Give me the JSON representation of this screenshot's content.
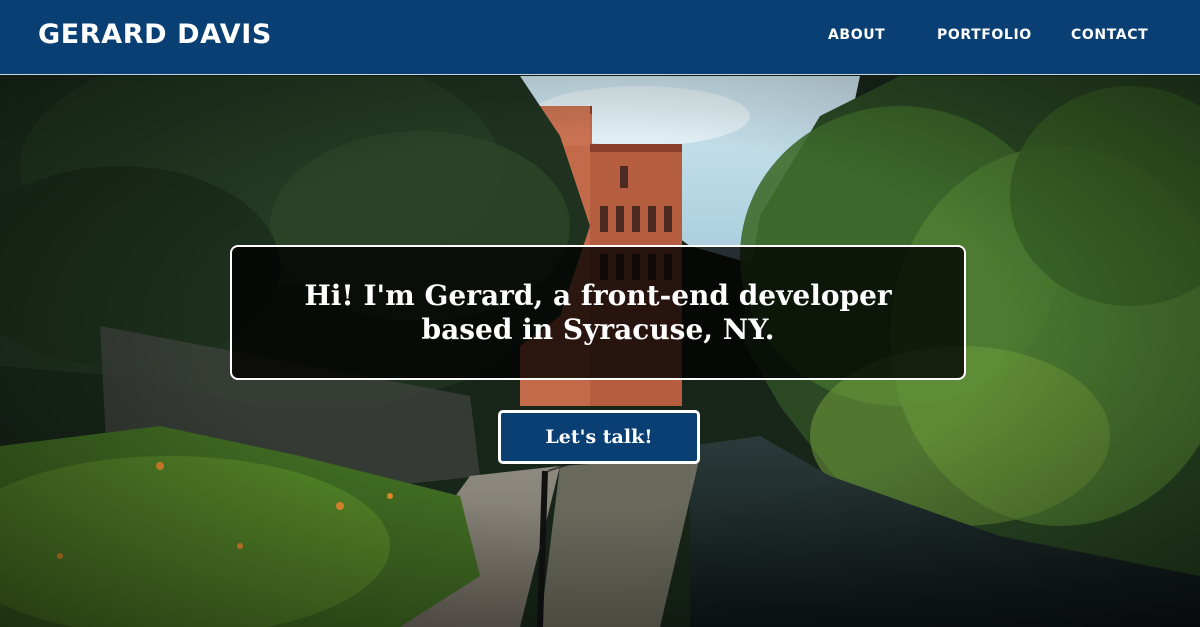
{
  "header": {
    "brand": "GERARD DAVIS",
    "nav": [
      {
        "label": "ABOUT"
      },
      {
        "label": "PORTFOLIO"
      },
      {
        "label": "CONTACT"
      }
    ]
  },
  "hero": {
    "headline": "Hi! I'm Gerard, a front-end developer based in Syracuse, NY.",
    "cta_label": "Let's talk!"
  },
  "colors": {
    "brand_blue": "#0a3f74",
    "text_white": "#ffffff"
  }
}
